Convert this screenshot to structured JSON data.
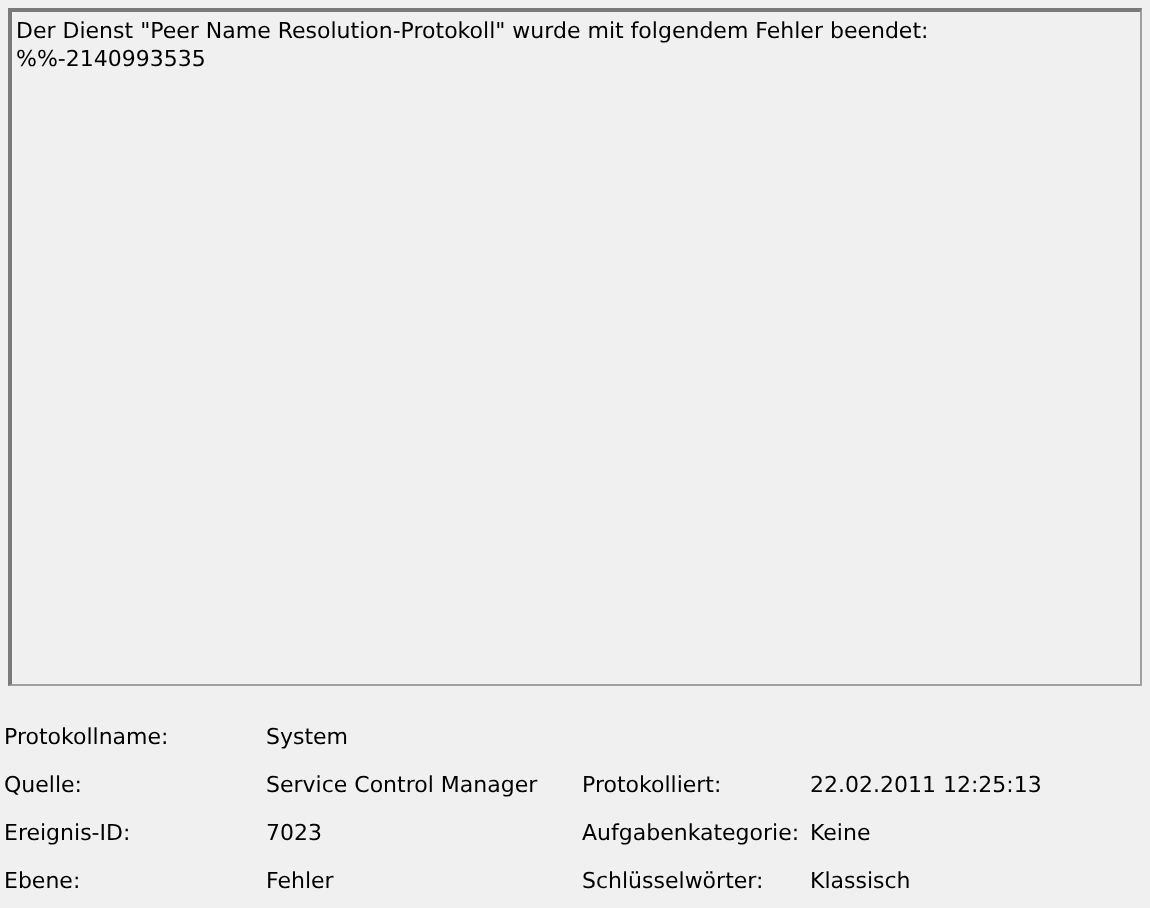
{
  "message": {
    "lines": [
      "Der Dienst \"Peer Name Resolution-Protokoll\" wurde mit folgendem Fehler beendet:",
      "%%-2140993535"
    ]
  },
  "details": [
    {
      "fields": [
        {
          "label": "Protokollname:",
          "value": "System"
        }
      ]
    },
    {
      "fields": [
        {
          "label": "Quelle:",
          "value": "Service Control Manager"
        },
        {
          "label": "Protokolliert:",
          "value": "22.02.2011 12:25:13"
        }
      ]
    },
    {
      "fields": [
        {
          "label": "Ereignis-ID:",
          "value": "7023"
        },
        {
          "label": "Aufgabenkategorie:",
          "value": "Keine"
        }
      ]
    },
    {
      "fields": [
        {
          "label": "Ebene:",
          "value": "Fehler"
        },
        {
          "label": "Schlüsselwörter:",
          "value": "Klassisch"
        }
      ]
    }
  ]
}
